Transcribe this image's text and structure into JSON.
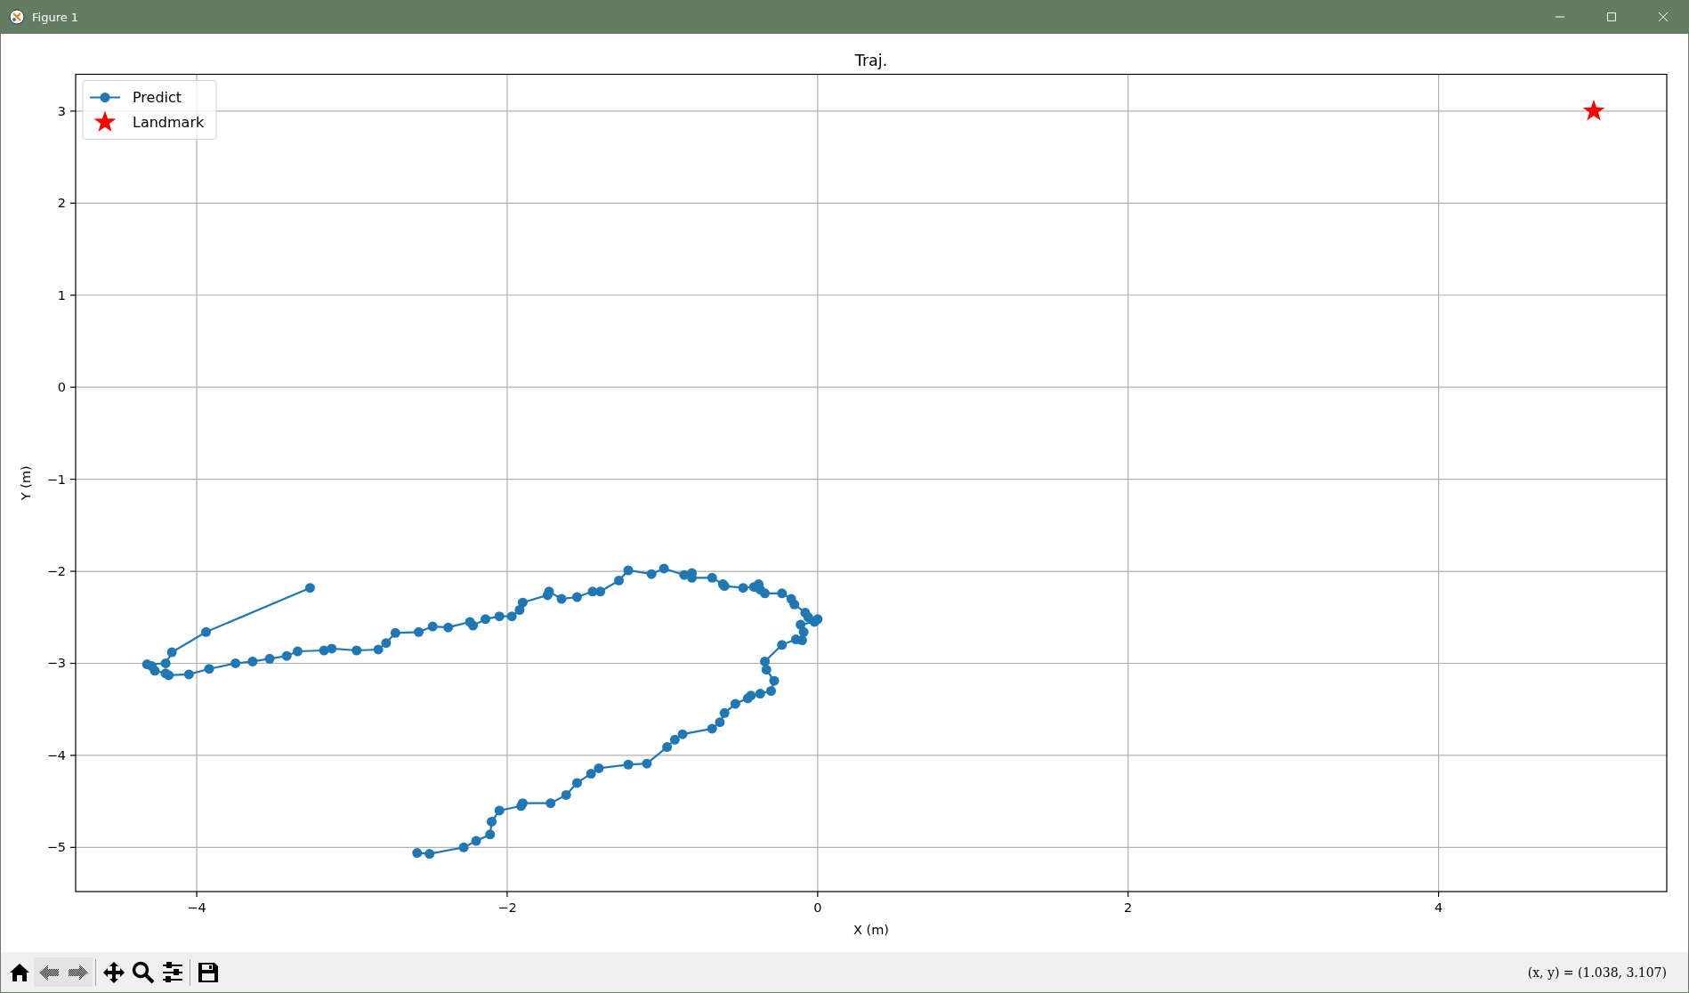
{
  "window": {
    "title": "Figure 1"
  },
  "figure": {
    "chart_data": {
      "type": "line",
      "title": "Traj.",
      "grid": true,
      "legend": true,
      "xlabel": "X (m)",
      "ylabel": "Y (m)",
      "xlim": [
        -4.78,
        5.47
      ],
      "ylim": [
        -5.48,
        3.4
      ],
      "xticks": [
        {
          "value": -4,
          "label": "−4"
        },
        {
          "value": -2,
          "label": "−2"
        },
        {
          "value": 0,
          "label": "0"
        },
        {
          "value": 2,
          "label": "2"
        },
        {
          "value": 4,
          "label": "4"
        }
      ],
      "yticks": [
        {
          "value": -5,
          "label": "−5"
        },
        {
          "value": -4,
          "label": "−4"
        },
        {
          "value": -3,
          "label": "−3"
        },
        {
          "value": -2,
          "label": "−2"
        },
        {
          "value": -1,
          "label": "−1"
        },
        {
          "value": 0,
          "label": "0"
        },
        {
          "value": 1,
          "label": "1"
        },
        {
          "value": 2,
          "label": "2"
        },
        {
          "value": 3,
          "label": "3"
        }
      ],
      "series": [
        {
          "name": "Predict",
          "marker": "o",
          "color": "#1f77b4",
          "x": [
            -3.27,
            -3.94,
            -4.16,
            -4.2,
            -4.32,
            -4.29,
            -4.27,
            -4.2,
            -4.18,
            -4.05,
            -3.92,
            -3.75,
            -3.64,
            -3.53,
            -3.42,
            -3.35,
            -3.18,
            -3.13,
            -2.97,
            -2.83,
            -2.78,
            -2.72,
            -2.57,
            -2.48,
            -2.38,
            -2.24,
            -2.22,
            -2.14,
            -2.05,
            -1.97,
            -1.92,
            -1.9,
            -1.74,
            -1.73,
            -1.65,
            -1.55,
            -1.45,
            -1.4,
            -1.28,
            -1.22,
            -1.07,
            -0.99,
            -0.86,
            -0.81,
            -0.81,
            -0.68,
            -0.61,
            -0.6,
            -0.48,
            -0.41,
            -0.38,
            -0.37,
            -0.34,
            -0.23,
            -0.17,
            -0.15,
            -0.08,
            -0.06,
            0,
            -0.02,
            -0.11,
            -0.09,
            -0.1,
            -0.14,
            -0.23,
            -0.34,
            -0.33,
            -0.28,
            -0.3,
            -0.37,
            -0.43,
            -0.45,
            -0.53,
            -0.6,
            -0.63,
            -0.68,
            -0.87,
            -0.92,
            -0.97,
            -1.1,
            -1.22,
            -1.41,
            -1.46,
            -1.55,
            -1.62,
            -1.72,
            -1.9,
            -1.91,
            -2.05,
            -2.1,
            -2.11,
            -2.2,
            -2.28,
            -2.5,
            -2.58
          ],
          "values": [
            -2.18,
            -2.66,
            -2.88,
            -3.0,
            -3.01,
            -3.03,
            -3.08,
            -3.11,
            -3.13,
            -3.12,
            -3.06,
            -3.0,
            -2.98,
            -2.95,
            -2.92,
            -2.87,
            -2.86,
            -2.84,
            -2.86,
            -2.85,
            -2.78,
            -2.67,
            -2.66,
            -2.6,
            -2.61,
            -2.55,
            -2.59,
            -2.52,
            -2.49,
            -2.49,
            -2.42,
            -2.34,
            -2.26,
            -2.22,
            -2.3,
            -2.28,
            -2.22,
            -2.22,
            -2.1,
            -1.99,
            -2.03,
            -1.97,
            -2.04,
            -2.02,
            -2.07,
            -2.07,
            -2.14,
            -2.16,
            -2.18,
            -2.17,
            -2.14,
            -2.2,
            -2.24,
            -2.24,
            -2.3,
            -2.36,
            -2.45,
            -2.5,
            -2.52,
            -2.55,
            -2.58,
            -2.66,
            -2.75,
            -2.74,
            -2.8,
            -2.98,
            -3.07,
            -3.19,
            -3.3,
            -3.33,
            -3.35,
            -3.38,
            -3.44,
            -3.54,
            -3.64,
            -3.71,
            -3.77,
            -3.83,
            -3.91,
            -4.09,
            -4.1,
            -4.14,
            -4.2,
            -4.3,
            -4.43,
            -4.52,
            -4.52,
            -4.55,
            -4.6,
            -4.72,
            -4.86,
            -4.93,
            -5.0,
            -5.07,
            -5.06
          ]
        },
        {
          "name": "Landmark",
          "marker": "*",
          "color": "#ff0000",
          "x": [
            5
          ],
          "values": [
            3
          ]
        }
      ]
    }
  },
  "toolbar": [
    {
      "kind": "home",
      "disabled": false
    },
    {
      "kind": "back",
      "disabled": true
    },
    {
      "kind": "forward",
      "disabled": true
    },
    {
      "kind": "pan",
      "disabled": false
    },
    {
      "kind": "zoom",
      "disabled": false
    },
    {
      "kind": "configure",
      "disabled": false
    },
    {
      "kind": "save",
      "disabled": false
    }
  ],
  "status_bar": {
    "text": "(x, y) = (1.038, 3.107)"
  }
}
